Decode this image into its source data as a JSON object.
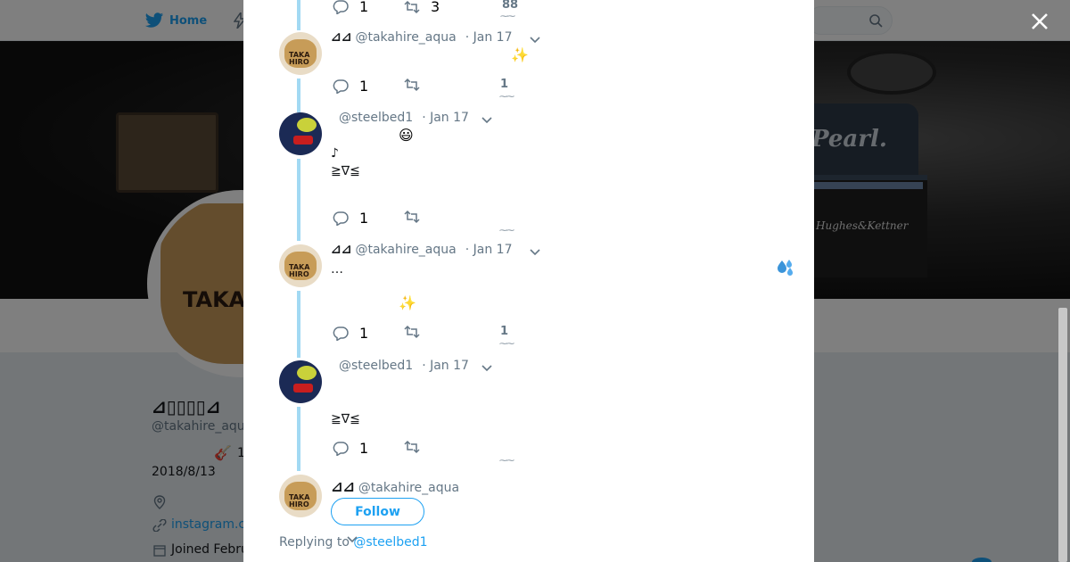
{
  "nav": {
    "home_label": "Home"
  },
  "background_profile": {
    "display_name": "⊿▯▯▯▯⊿",
    "handle": "@takahire_aqua",
    "guitar_count": "1",
    "date_text": "2018/8/13",
    "link_text": "instagram.c",
    "joined_text": "Joined Febru"
  },
  "modal": {
    "tweets": [
      {
        "name": "",
        "handle": "",
        "time": "",
        "text": "",
        "replies": "1",
        "retweets": "3",
        "likes": "88",
        "avatar": "none"
      },
      {
        "name": "⊿⊿",
        "handle": "@takahire_aqua",
        "time": "· Jan 17",
        "text": "",
        "replies": "1",
        "retweets": "",
        "likes": "1",
        "avatar": "takahire"
      },
      {
        "name": "",
        "handle": "@steelbed1",
        "time": "· Jan 17",
        "text": "♪\n≧∇≦",
        "replies": "1",
        "retweets": "",
        "likes": "",
        "avatar": "steelbed"
      },
      {
        "name": "⊿⊿",
        "handle": "@takahire_aqua",
        "time": "· Jan 17",
        "text": "…",
        "replies": "1",
        "retweets": "",
        "likes": "1",
        "avatar": "takahire"
      },
      {
        "name": "",
        "handle": "@steelbed1",
        "time": "· Jan 17",
        "text": "≧∇≦",
        "replies": "1",
        "retweets": "",
        "likes": "",
        "avatar": "steelbed"
      }
    ],
    "main_tweet": {
      "name": "⊿⊿",
      "handle": "@takahire_aqua",
      "follow_label": "Follow",
      "replying_prefix": "Replying to",
      "replying_handle": "@steelbed1"
    },
    "emojis": {
      "sparkles": "✨",
      "smile": "😃"
    }
  },
  "colors": {
    "accent": "#1da1f2",
    "thread_line": "#a2d9f3",
    "muted_text": "#657786",
    "primary_text": "#14171a"
  }
}
